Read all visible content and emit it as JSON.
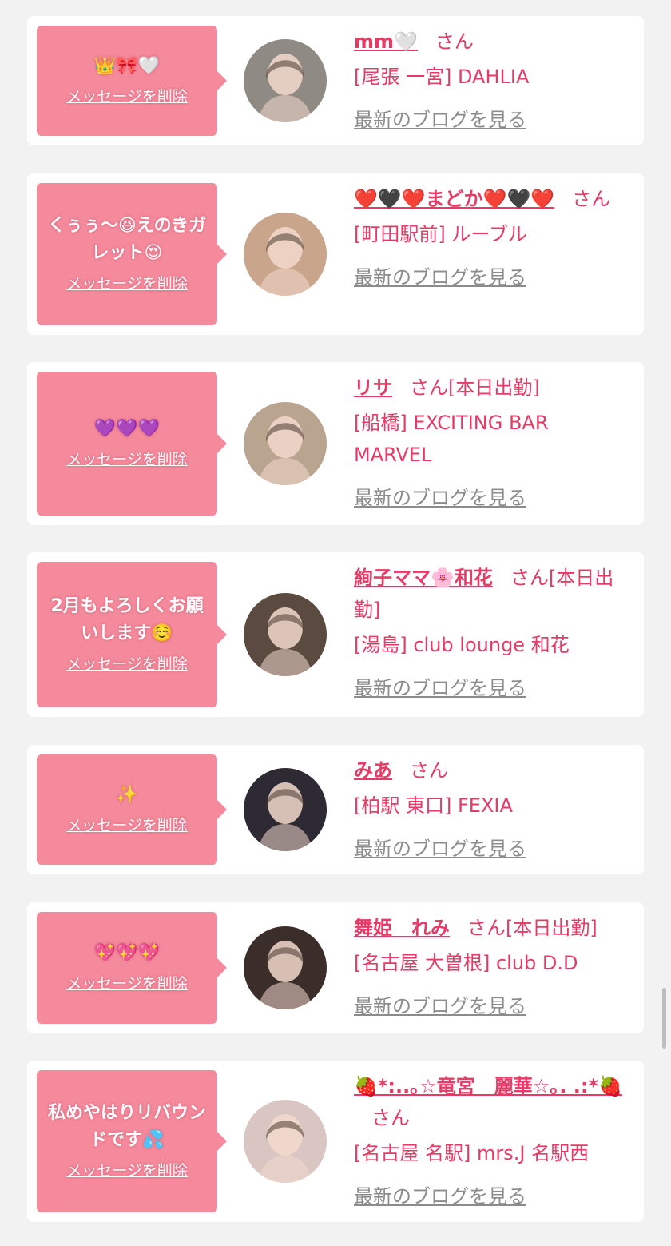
{
  "cards": [
    {
      "message": "👑🎀🤍",
      "delete_label": "メッセージを削除",
      "name": "mm🤍",
      "san": "さん",
      "status": "",
      "location": "[尾張 一宮] DAHLIA",
      "blog_label": "最新のブログを見る",
      "avatar_color": "#8f8a84"
    },
    {
      "message": "くぅぅ〜😆えのきガレット😍",
      "delete_label": "メッセージを削除",
      "name": "❤️🖤❤️まどか❤️🖤❤️",
      "san": "さん",
      "status": "",
      "location": "[町田駅前] ルーブル",
      "blog_label": "最新のブログを見る",
      "avatar_color": "#c9a58c"
    },
    {
      "message": "💜💜💜",
      "delete_label": "メッセージを削除",
      "name": "リサ",
      "san": "さん",
      "status": "[本日出勤]",
      "location": "[船橋] EXCITING BAR MARVEL",
      "blog_label": "最新のブログを見る",
      "avatar_color": "#b9a48f"
    },
    {
      "message": "2月もよろしくお願いします☺️",
      "delete_label": "メッセージを削除",
      "name": "絢子ママ🌸和花",
      "san": "さん",
      "status": "[本日出勤]",
      "location": "[湯島] club lounge 和花",
      "blog_label": "最新のブログを見る",
      "avatar_color": "#5a4a40"
    },
    {
      "message": "✨",
      "delete_label": "メッセージを削除",
      "name": "みあ",
      "san": "さん",
      "status": "",
      "location": "[柏駅 東口] FEXIA",
      "blog_label": "最新のブログを見る",
      "avatar_color": "#2e2a33"
    },
    {
      "message": "💖💖💖",
      "delete_label": "メッセージを削除",
      "name": "舞姫　れみ",
      "san": "さん",
      "status": "[本日出勤]",
      "location": "[名古屋 大曽根] club D.D",
      "blog_label": "最新のブログを見る",
      "avatar_color": "#3a2d2a"
    },
    {
      "message": "私めやはりリバウンドです💦",
      "delete_label": "メッセージを削除",
      "name": "🍓*:..｡☆竜宮　麗華☆｡. .:*🍓",
      "san": "さん",
      "status": "",
      "location": "[名古屋 名駅] mrs.J 名駅西",
      "blog_label": "最新のブログを見る",
      "avatar_color": "#d9c6c2"
    }
  ]
}
